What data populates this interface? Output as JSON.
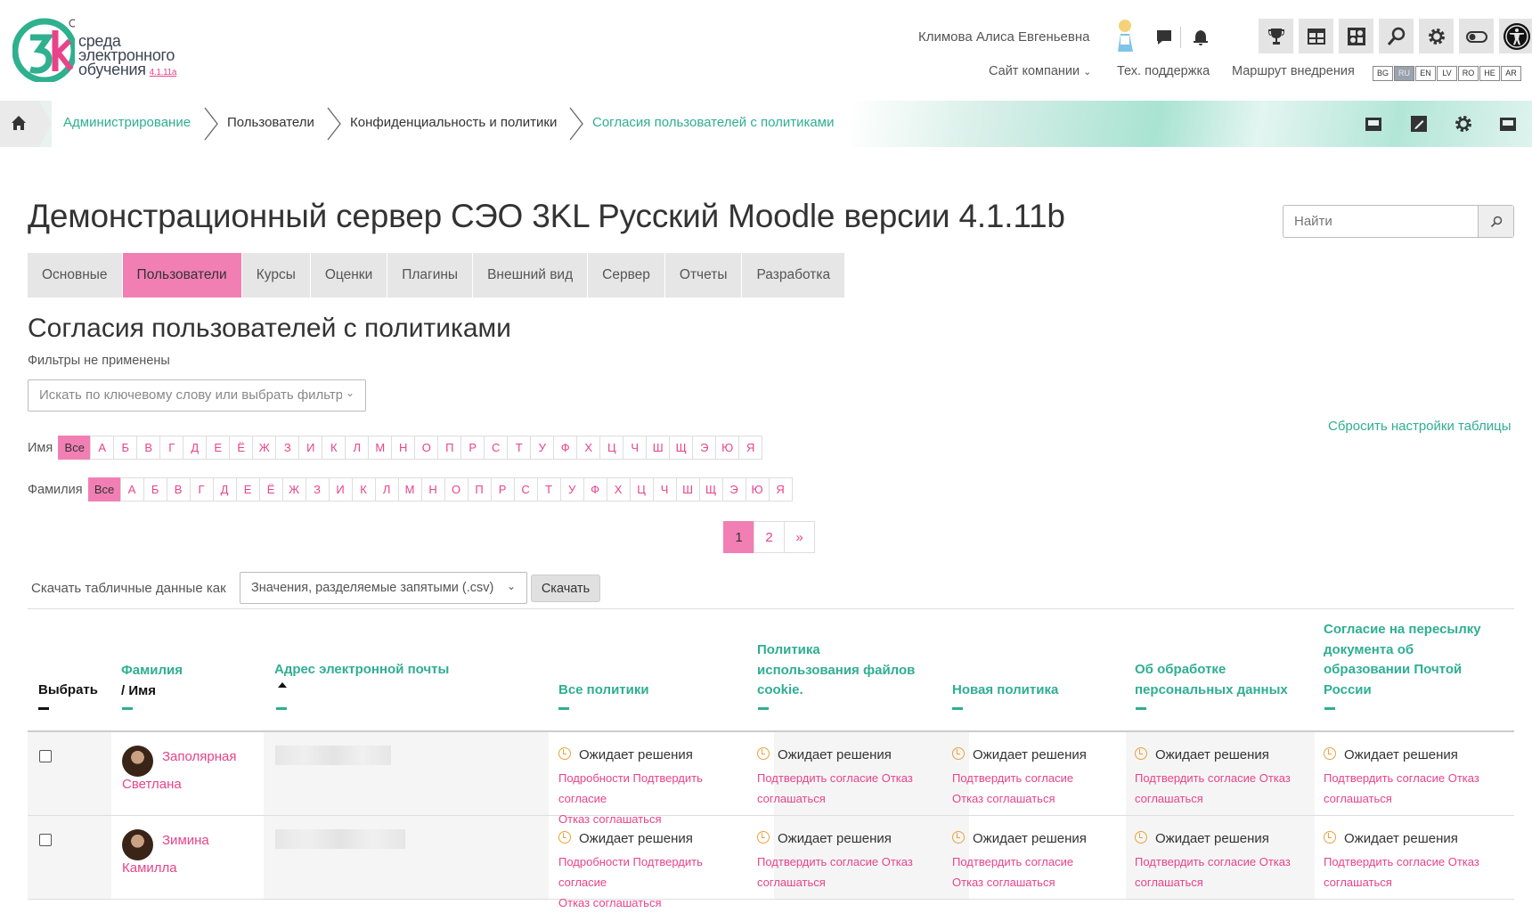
{
  "logo": {
    "line1": "среда",
    "line2": "электронного",
    "line3": "обучения",
    "version": "4.1.11a",
    "mark": "3K"
  },
  "header": {
    "user_name": "Климова Алиса Евгеньевна",
    "links": [
      "Сайт компании",
      "Тех. поддержка",
      "Маршрут внедрения"
    ],
    "languages": [
      "BG",
      "RU",
      "EN",
      "LV",
      "RO",
      "HE",
      "AR"
    ],
    "active_language": "RU"
  },
  "breadcrumb": [
    "Администрирование",
    "Пользователи",
    "Конфиденциальность и политики",
    "Согласия пользователей с политиками"
  ],
  "page_title": "Демонстрационный сервер СЭО 3KL Русский Moodle версии 4.1.11b",
  "search": {
    "placeholder": "Найти"
  },
  "tabs": [
    "Основные",
    "Пользователи",
    "Курсы",
    "Оценки",
    "Плагины",
    "Внешний вид",
    "Сервер",
    "Отчеты",
    "Разработка"
  ],
  "active_tab": "Пользователи",
  "section_title": "Согласия пользователей с политиками",
  "filters_status": "Фильтры не применены",
  "filter_select": "Искать по ключевому слову или выбрать фильтр",
  "reset_link": "Сбросить настройки таблицы",
  "initials": {
    "first_label": "Имя",
    "last_label": "Фамилия",
    "all": "Все",
    "letters": [
      "А",
      "Б",
      "В",
      "Г",
      "Д",
      "Е",
      "Ё",
      "Ж",
      "З",
      "И",
      "К",
      "Л",
      "М",
      "Н",
      "О",
      "П",
      "Р",
      "С",
      "Т",
      "У",
      "Ф",
      "Х",
      "Ц",
      "Ч",
      "Ш",
      "Щ",
      "Э",
      "Ю",
      "Я"
    ]
  },
  "pagination": [
    "1",
    "2",
    "»"
  ],
  "download": {
    "label": "Скачать табличные данные как",
    "format": "Значения, разделяемые запятыми (.csv)",
    "button": "Скачать"
  },
  "table": {
    "headers": {
      "select": "Выбрать",
      "name1": "Фамилия",
      "name2": "/ Имя",
      "email": "Адрес электронной почты",
      "all": "Все политики",
      "cookie1": "Политика",
      "cookie2": "использования файлов",
      "cookie3": "cookie.",
      "newp": "Новая политика",
      "pd1": "Об обработке",
      "pd2": "персональных данных",
      "post1": "Согласие на пересылку",
      "post2": "документа об",
      "post3": "образовании Почтой",
      "post4": "России"
    },
    "status": "Ожидает решения",
    "action_details": "Подробности",
    "action_accept": "Подтвердить согласие",
    "action_decline": "Отказ соглашаться",
    "rows": [
      {
        "last": "Заполярная",
        "first": "Светлана"
      },
      {
        "last": "Зимина",
        "first": "Камилла"
      }
    ]
  },
  "colors": {
    "accent": "#f17fb4",
    "link": "#e8438a",
    "teal": "#2fae93"
  }
}
